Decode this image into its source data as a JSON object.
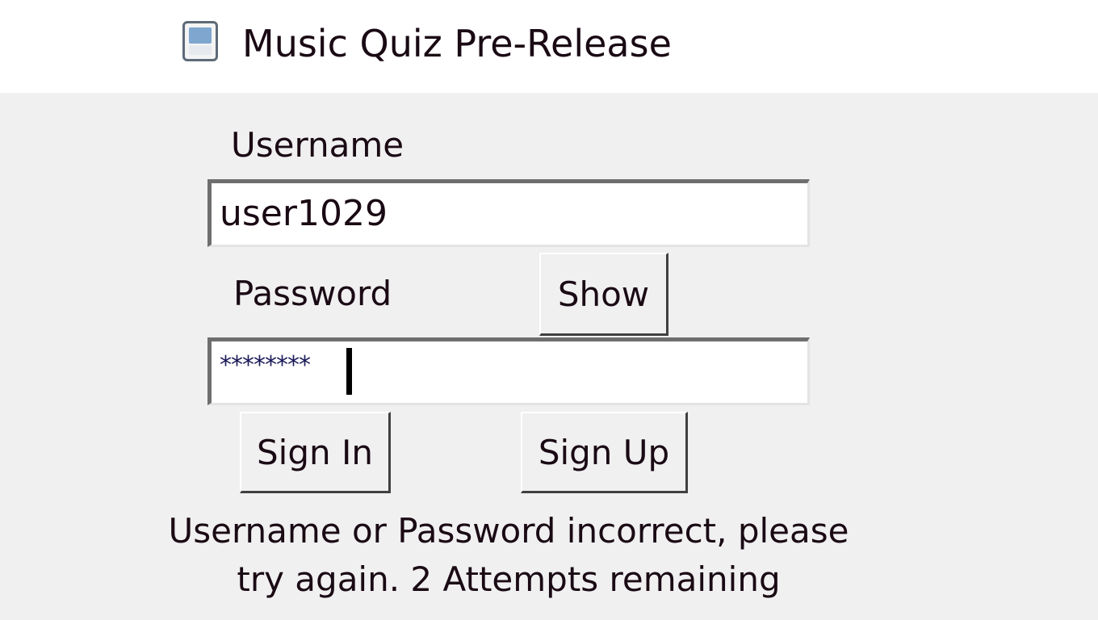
{
  "window": {
    "title": "Music Quiz Pre-Release",
    "icon": "window-app-icon"
  },
  "login": {
    "username_label": "Username",
    "username_value": "user1029",
    "password_label": "Password",
    "password_value": "********",
    "show_label": "Show",
    "sign_in_label": "Sign In",
    "sign_up_label": "Sign Up"
  },
  "status": {
    "line1": "Username or Password incorrect, please",
    "line2": "try again. 2 Attempts remaining"
  },
  "colors": {
    "background": "#f0f0f0",
    "titlebar": "#ffffff",
    "text": "#1a0a14"
  }
}
